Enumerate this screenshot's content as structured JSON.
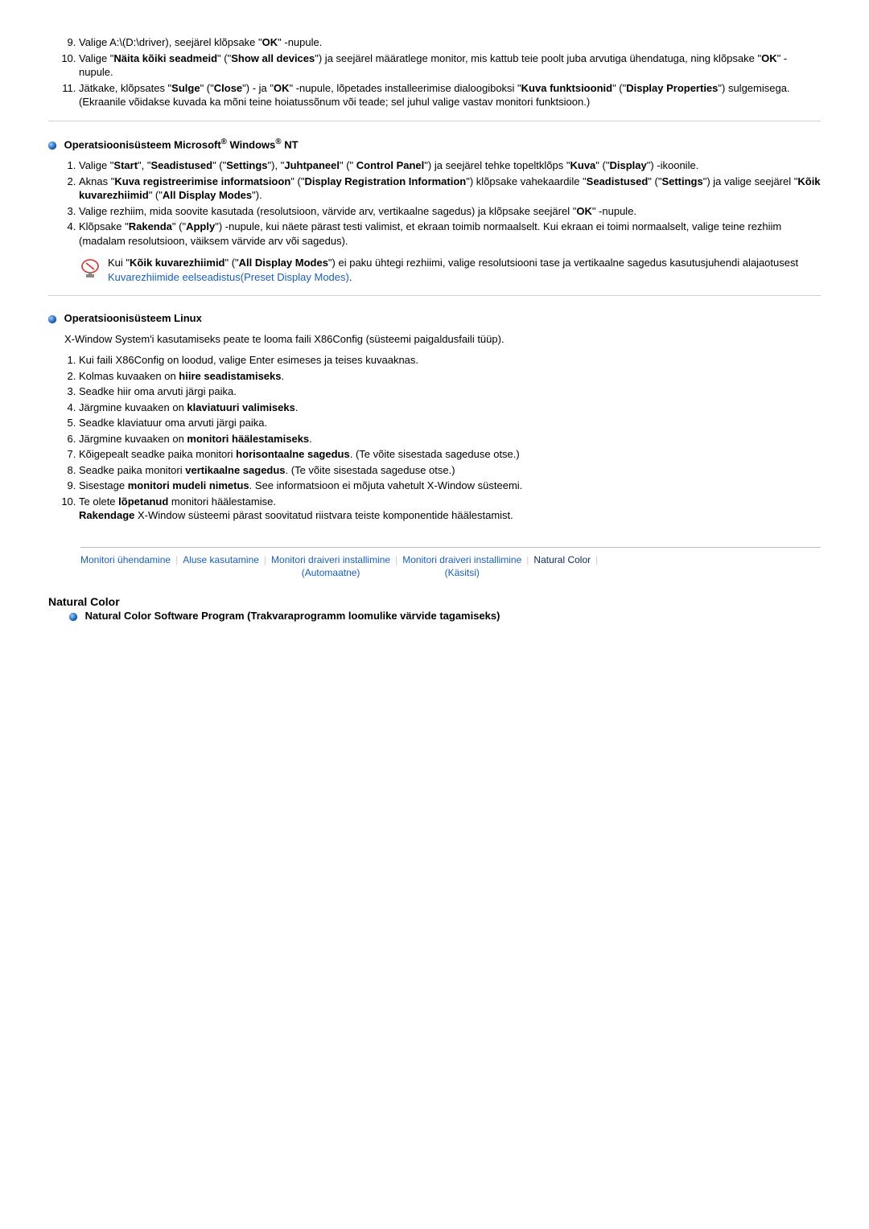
{
  "top_list": {
    "items": [
      {
        "pre": "Valige A:\\(D:\\driver), seejärel klõpsake \"",
        "b1": "OK",
        "post": "\" -nupule."
      },
      {
        "parts": [
          "Valige \"",
          "Näita kõiki seadmeid",
          "\" (\"",
          "Show all devices",
          "\") ja seejärel määratlege monitor, mis kattub teie poolt juba arvutiga ühendatuga, ning klõpsake \"",
          "OK",
          "\" -nupule."
        ]
      },
      {
        "parts": [
          "Jätkake, klõpsates \"",
          "Sulge",
          "\" (\"",
          "Close",
          "\") - ja \"",
          "OK",
          "\" -nupule, lõpetades installeerimise dialoogiboksi \"",
          "Kuva funktsioonid",
          "\" (\"",
          "Display Properties",
          "\") sulgemisega.\n(Ekraanile võidakse kuvada ka mõni teine hoiatussõnum või teade; sel juhul valige vastav monitori funktsioon.)"
        ]
      }
    ]
  },
  "nt_heading": {
    "pre": "Operatsioonisüsteem Microsoft",
    "reg": "®",
    "mid": " Windows",
    "suf": " NT"
  },
  "nt_list": {
    "items": [
      {
        "parts": [
          "Valige \"",
          "Start",
          "\", \"",
          "Seadistused",
          "\" (\"",
          "Settings",
          "\"), \"",
          "Juhtpaneel",
          "\" (\" ",
          "Control Panel",
          "\") ja seejärel tehke topeltklõps \"",
          "Kuva",
          "\" (\"",
          "Display",
          "\") -ikoonile."
        ]
      },
      {
        "parts": [
          "Aknas \"",
          "Kuva registreerimise informatsioon",
          "\" (\"",
          "Display Registration Information",
          "\") klõpsake vahekaardile \"",
          "Seadistused",
          "\" (\"",
          "Settings",
          "\") ja valige seejärel \"",
          "Kõik kuvarezhiimid",
          "\" (\"",
          "All Display Modes",
          "\")."
        ]
      },
      {
        "parts": [
          "Valige rezhiim, mida soovite kasutada (resolutsioon, värvide arv, vertikaalne sagedus) ja klõpsake seejärel \"",
          "OK",
          "\" -nupule."
        ]
      },
      {
        "parts": [
          "Klõpsake \"",
          "Rakenda",
          "\" (\"",
          "Apply",
          "\") -nupule, kui näete pärast testi valimist, et ekraan toimib normaalselt. Kui ekraan ei toimi normaalselt, valige teine rezhiim (madalam resolutsioon, väiksem värvide arv või sagedus)."
        ]
      }
    ]
  },
  "note": {
    "pre": "Kui \"",
    "b": "Kõik kuvarezhiimid",
    "mid": "\" (\"",
    "b2": "All Display Modes",
    "post": "\") ei paku ühtegi rezhiimi, valige resolutsiooni tase ja vertikaalne sagedus kasutusjuhendi alajaotusest ",
    "link": "Kuvarezhiimide eelseadistus(Preset Display Modes)",
    "end": "."
  },
  "linux_heading": "Operatsioonisüsteem Linux",
  "linux_intro": "X-Window System'i kasutamiseks peate te looma faili X86Config (süsteemi paigaldusfaili tüüp).",
  "linux_list": {
    "items": [
      {
        "text": "Kui faili X86Config on loodud, valige Enter esimeses ja teises kuvaaknas."
      },
      {
        "parts": [
          "Kolmas kuvaaken on ",
          "hiire seadistamiseks",
          "."
        ]
      },
      {
        "text": "Seadke hiir oma arvuti järgi paika."
      },
      {
        "parts": [
          "Järgmine kuvaaken on ",
          "klaviatuuri valimiseks",
          "."
        ]
      },
      {
        "text": "Seadke klaviatuur oma arvuti järgi paika."
      },
      {
        "parts": [
          "Järgmine kuvaaken on ",
          "monitori häälestamiseks",
          "."
        ]
      },
      {
        "parts": [
          "Kõigepealt seadke paika monitori ",
          "horisontaalne sagedus",
          ". (Te võite sisestada sageduse otse.)"
        ]
      },
      {
        "parts": [
          "Seadke paika monitori ",
          "vertikaalne sagedus",
          ". (Te võite sisestada sageduse otse.)"
        ]
      },
      {
        "parts": [
          "Sisestage ",
          "monitori mudeli nimetus",
          ". See informatsioon ei mõjuta vahetult X-Window süsteemi."
        ]
      },
      {
        "parts": [
          "Te olete ",
          "lõpetanud",
          " monitori häälestamise.\n",
          "Rakendage",
          " X-Window süsteemi pärast soovitatud riistvara teiste komponentide häälestamist."
        ]
      }
    ]
  },
  "nav": {
    "a": "Monitori ühendamine",
    "b": "Aluse kasutamine",
    "c1": "Monitori draiveri installimine",
    "c2": "(Automaatne)",
    "d1": "Monitori draiveri installimine",
    "d2": "(Käsitsi)",
    "e": "Natural Color"
  },
  "nc_heading": "Natural Color",
  "nc_sub": "Natural Color Software Program (Trakvaraprogramm loomulike värvide tagamiseks)"
}
